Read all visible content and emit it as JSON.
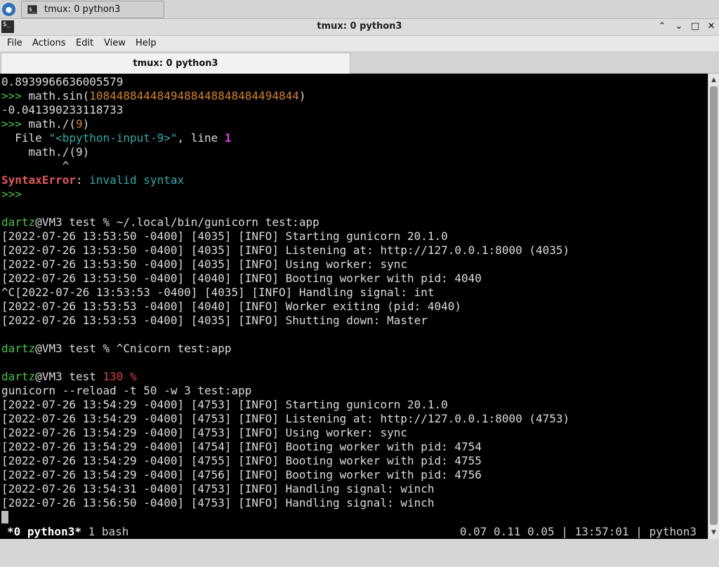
{
  "taskbar": {
    "task_label": "tmux: 0 python3",
    "terminal_glyph": "$_"
  },
  "window": {
    "title": "tmux: 0 python3",
    "minimize_glyph": "⌃",
    "maximize_glyph": "⌄",
    "restore_glyph": "□",
    "close_glyph": "✕"
  },
  "menu": [
    "File",
    "Actions",
    "Edit",
    "View",
    "Help"
  ],
  "tab": {
    "label": "tmux: 0 python3"
  },
  "terminal": {
    "lines": [
      {
        "parts": [
          {
            "t": "0.8939966636005579"
          }
        ]
      },
      {
        "parts": [
          {
            "t": ">>> ",
            "c": "green"
          },
          {
            "t": "math.sin("
          },
          {
            "t": "1084488444849488448848484494844",
            "c": "orange"
          },
          {
            "t": ")"
          }
        ]
      },
      {
        "parts": [
          {
            "t": "-0.041390233118733"
          }
        ]
      },
      {
        "parts": [
          {
            "t": ">>> ",
            "c": "green"
          },
          {
            "t": "math./("
          },
          {
            "t": "9",
            "c": "orange"
          },
          {
            "t": ")"
          }
        ]
      },
      {
        "parts": [
          {
            "t": "  File "
          },
          {
            "t": "\"<bpython-input-9>\"",
            "c": "cyan"
          },
          {
            "t": ", line "
          },
          {
            "t": "1",
            "c": "magenta"
          }
        ]
      },
      {
        "parts": [
          {
            "t": "    math./(9)"
          }
        ]
      },
      {
        "parts": [
          {
            "t": "         ^"
          }
        ]
      },
      {
        "parts": [
          {
            "t": "SyntaxError",
            "c": "red"
          },
          {
            "t": ": "
          },
          {
            "t": "invalid syntax",
            "c": "cyan"
          }
        ]
      },
      {
        "parts": [
          {
            "t": ">>>",
            "c": "green"
          }
        ]
      },
      {
        "parts": [
          {
            "t": ""
          }
        ]
      },
      {
        "parts": [
          {
            "t": "dartz",
            "c": "green"
          },
          {
            "t": "@VM3 test % ~/.local/bin/gunicorn test:app"
          }
        ]
      },
      {
        "parts": [
          {
            "t": "[2022-07-26 13:53:50 -0400] [4035] [INFO] Starting gunicorn 20.1.0"
          }
        ]
      },
      {
        "parts": [
          {
            "t": "[2022-07-26 13:53:50 -0400] [4035] [INFO] Listening at: http://127.0.0.1:8000 (4035)"
          }
        ]
      },
      {
        "parts": [
          {
            "t": "[2022-07-26 13:53:50 -0400] [4035] [INFO] Using worker: sync"
          }
        ]
      },
      {
        "parts": [
          {
            "t": "[2022-07-26 13:53:50 -0400] [4040] [INFO] Booting worker with pid: 4040"
          }
        ]
      },
      {
        "parts": [
          {
            "t": "^C[2022-07-26 13:53:53 -0400] [4035] [INFO] Handling signal: int"
          }
        ]
      },
      {
        "parts": [
          {
            "t": "[2022-07-26 13:53:53 -0400] [4040] [INFO] Worker exiting (pid: 4040)"
          }
        ]
      },
      {
        "parts": [
          {
            "t": "[2022-07-26 13:53:53 -0400] [4035] [INFO] Shutting down: Master"
          }
        ]
      },
      {
        "parts": [
          {
            "t": ""
          }
        ]
      },
      {
        "parts": [
          {
            "t": "dartz",
            "c": "green"
          },
          {
            "t": "@VM3 test % ^Cnicorn test:app"
          }
        ]
      },
      {
        "parts": [
          {
            "t": ""
          }
        ]
      },
      {
        "parts": [
          {
            "t": "dartz",
            "c": "green"
          },
          {
            "t": "@VM3 test "
          },
          {
            "t": "130 %",
            "c": "redtxt"
          }
        ]
      },
      {
        "parts": [
          {
            "t": "gunicorn --reload -t 50 -w 3 test:app"
          }
        ]
      },
      {
        "parts": [
          {
            "t": "[2022-07-26 13:54:29 -0400] [4753] [INFO] Starting gunicorn 20.1.0"
          }
        ]
      },
      {
        "parts": [
          {
            "t": "[2022-07-26 13:54:29 -0400] [4753] [INFO] Listening at: http://127.0.0.1:8000 (4753)"
          }
        ]
      },
      {
        "parts": [
          {
            "t": "[2022-07-26 13:54:29 -0400] [4753] [INFO] Using worker: sync"
          }
        ]
      },
      {
        "parts": [
          {
            "t": "[2022-07-26 13:54:29 -0400] [4754] [INFO] Booting worker with pid: 4754"
          }
        ]
      },
      {
        "parts": [
          {
            "t": "[2022-07-26 13:54:29 -0400] [4755] [INFO] Booting worker with pid: 4755"
          }
        ]
      },
      {
        "parts": [
          {
            "t": "[2022-07-26 13:54:29 -0400] [4756] [INFO] Booting worker with pid: 4756"
          }
        ]
      },
      {
        "parts": [
          {
            "t": "[2022-07-26 13:54:31 -0400] [4753] [INFO] Handling signal: winch"
          }
        ]
      },
      {
        "parts": [
          {
            "t": "[2022-07-26 13:56:50 -0400] [4753] [INFO] Handling signal: winch"
          }
        ]
      }
    ]
  },
  "status": {
    "active_window": "*0 python3*",
    "other_window": " 1 bash",
    "load": "0.07 0.11 0.05",
    "separator": " | ",
    "time": "13:57:01",
    "host": "python3"
  },
  "scrollbar": {
    "up_glyph": "▲",
    "down_glyph": "▼"
  },
  "colors": {
    "green": "#4cc24c",
    "orange": "#d2822e",
    "red": "#e05a5a",
    "redtxt": "#d84040",
    "cyan": "#38a9a9",
    "magenta": "#e040e0",
    "background": "#000000"
  }
}
